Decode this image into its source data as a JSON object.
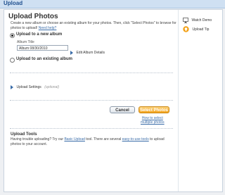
{
  "app": {
    "title": "Upload"
  },
  "main": {
    "title": "Upload Photos",
    "intro_text": "Create a new album or choose an existing album for your photos. Then, click \"Select Photos\" to browse for photos to upload!",
    "need_help": "Need help?",
    "new_album": {
      "label": "Upload to a new album",
      "selected": true,
      "field_label": "Album Title",
      "field_value": "Album 08/30/2010",
      "edit_label": "Edit Album Details"
    },
    "existing_album": {
      "label": "Upload to an existing album",
      "selected": false
    },
    "settings": {
      "label": "Upload Settings",
      "optional": "(optional)"
    },
    "buttons": {
      "cancel": "Cancel",
      "select": "Select Photos"
    },
    "how_to": [
      "How to select",
      "multiple photos"
    ],
    "tools": {
      "title": "Upload Tools",
      "text_1": "Having trouble uploading? Try our",
      "basic_link": "Basic Upload",
      "text_2": "tool. There are several",
      "easy_link": "easy-to-use tools",
      "text_3": "to upload photos to your account."
    }
  },
  "side": {
    "watch_demo": "Watch Demo",
    "upload_tip": "Upload Tip"
  },
  "colors": {
    "accent": "#3a6ca8",
    "select_button": "#f3a21a",
    "header": "#cfe0f2"
  }
}
